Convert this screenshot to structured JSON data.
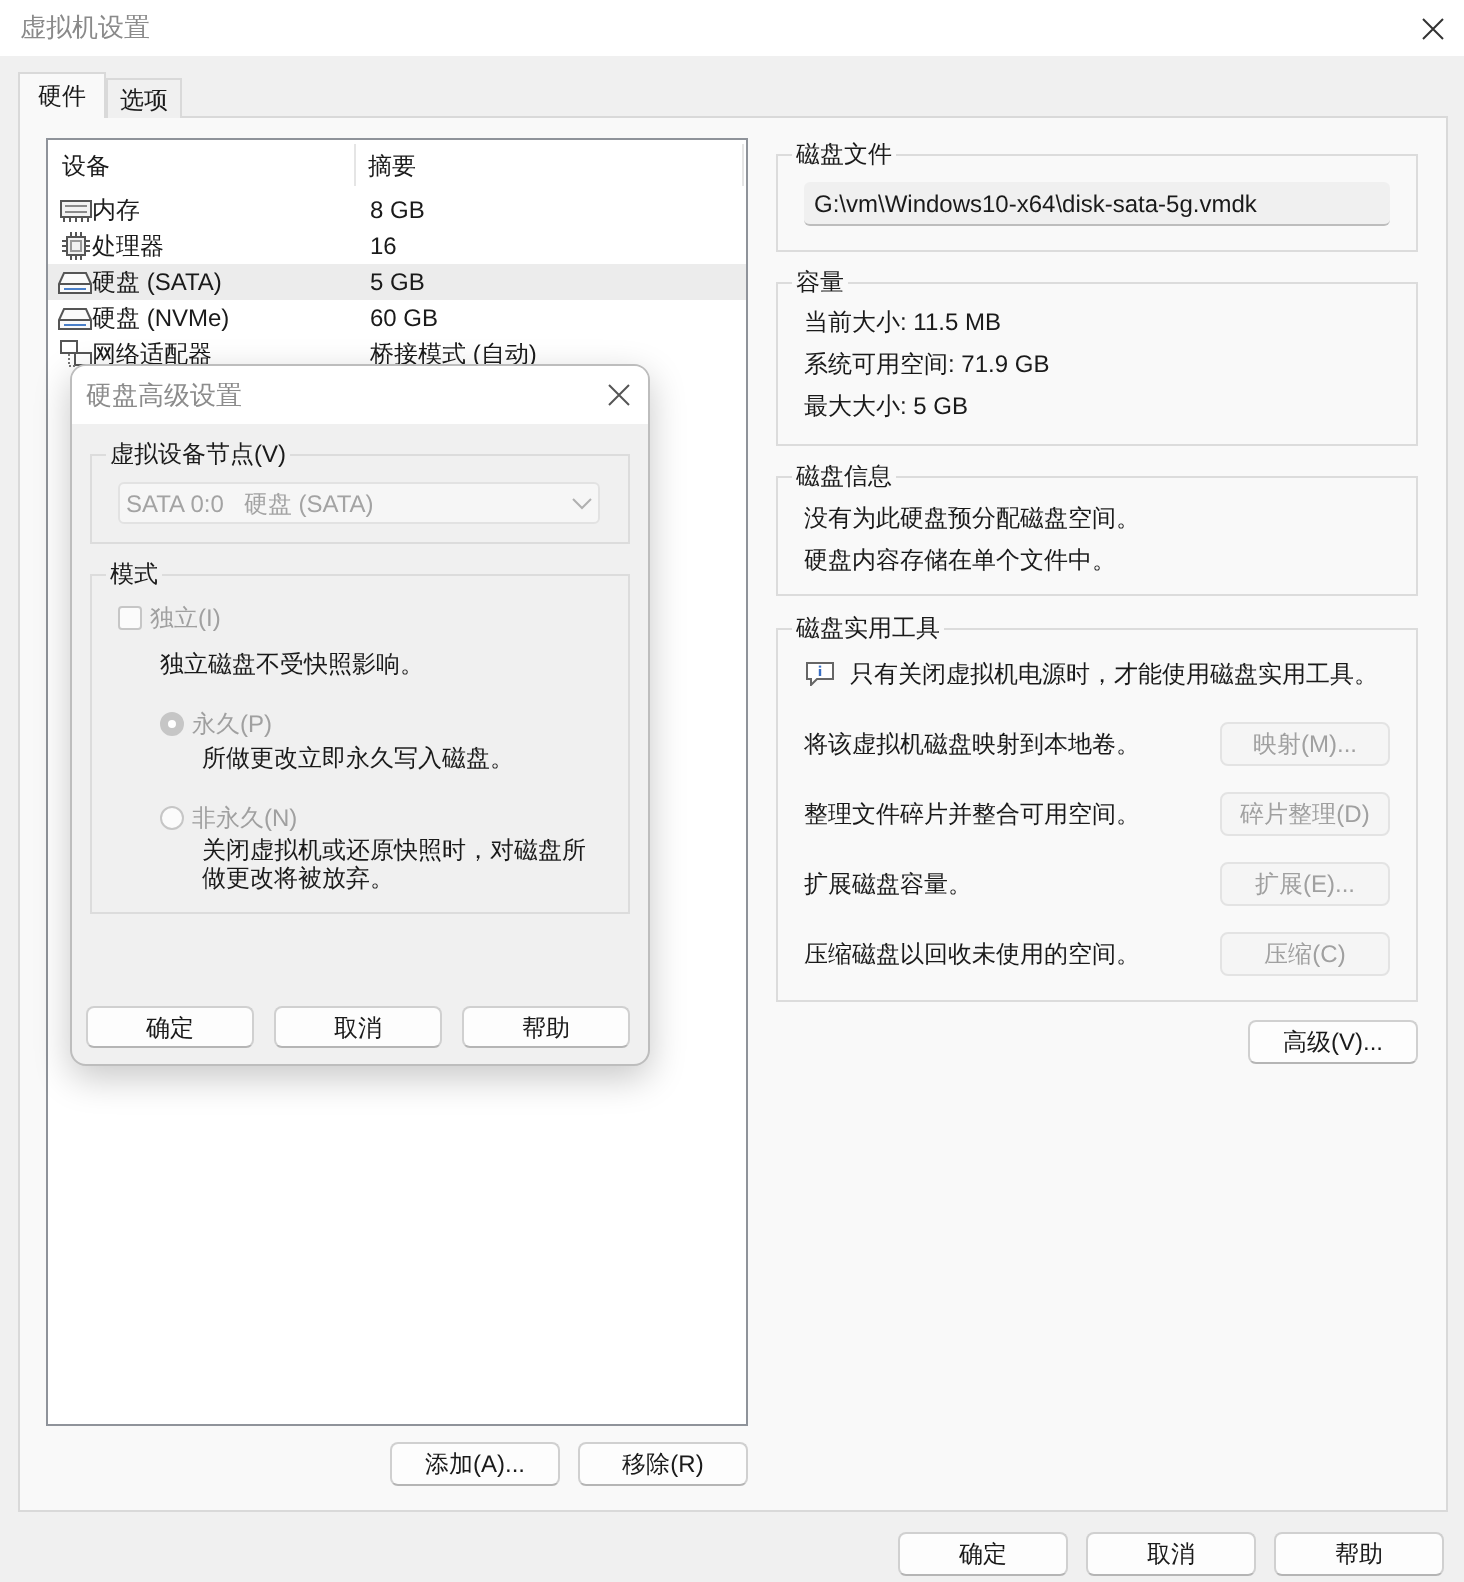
{
  "window": {
    "title": "虚拟机设置"
  },
  "tabs": [
    {
      "label": "硬件",
      "selected": true
    },
    {
      "label": "选项",
      "selected": false
    }
  ],
  "device_list": {
    "columns": [
      "设备",
      "摘要"
    ],
    "rows": [
      {
        "kind": "memory",
        "device": "内存",
        "summary": "8 GB",
        "selected": false
      },
      {
        "kind": "processor",
        "device": "处理器",
        "summary": "16",
        "selected": false
      },
      {
        "kind": "disk",
        "device": "硬盘 (SATA)",
        "summary": "5 GB",
        "selected": true
      },
      {
        "kind": "disk",
        "device": "硬盘 (NVMe)",
        "summary": "60 GB",
        "selected": false
      },
      {
        "kind": "network",
        "device": "网络适配器",
        "summary": "桥接模式 (自动)",
        "selected": false
      }
    ]
  },
  "list_buttons": [
    "添加(A)...",
    "移除(R)"
  ],
  "disk_file": {
    "title": "磁盘文件",
    "path": "G:\\vm\\Windows10-x64\\disk-sata-5g.vmdk"
  },
  "capacity": {
    "title": "容量",
    "lines": [
      "当前大小: 11.5 MB",
      "系统可用空间: 71.9 GB",
      "最大大小: 5 GB"
    ]
  },
  "disk_info": {
    "title": "磁盘信息",
    "lines": [
      "没有为此硬盘预分配磁盘空间。",
      "硬盘内容存储在单个文件中。"
    ]
  },
  "disk_utilities": {
    "title": "磁盘实用工具",
    "notice": "只有关闭虚拟机电源时，才能使用磁盘实用工具。",
    "rows": [
      {
        "text": "将该虚拟机磁盘映射到本地卷。",
        "button": "映射(M)...",
        "disabled": true
      },
      {
        "text": "整理文件碎片并整合可用空间。",
        "button": "碎片整理(D)",
        "disabled": true
      },
      {
        "text": "扩展磁盘容量。",
        "button": "扩展(E)...",
        "disabled": true
      },
      {
        "text": "压缩磁盘以回收未使用的空间。",
        "button": "压缩(C)",
        "disabled": true
      }
    ]
  },
  "advanced_button": {
    "label": "高级(V)...",
    "disabled": false
  },
  "dialog": {
    "title": "硬盘高级设置",
    "node_group": {
      "title": "虚拟设备节点(V)",
      "value": "SATA 0:0   硬盘 (SATA)",
      "disabled": true
    },
    "mode_group": {
      "title": "模式",
      "independent": {
        "label": "独立(I)",
        "checked": false,
        "disabled": true
      },
      "independent_note": "独立磁盘不受快照影响。",
      "options": [
        {
          "label": "永久(P)",
          "selected": true,
          "disabled": true,
          "note": "所做更改立即永久写入磁盘。"
        },
        {
          "label": "非永久(N)",
          "selected": false,
          "disabled": true,
          "note": "关闭虚拟机或还原快照时，对磁盘所做更改将被放弃。"
        }
      ]
    },
    "buttons": [
      "确定",
      "取消",
      "帮助"
    ]
  },
  "footer_buttons": [
    "确定",
    "取消",
    "帮助"
  ]
}
